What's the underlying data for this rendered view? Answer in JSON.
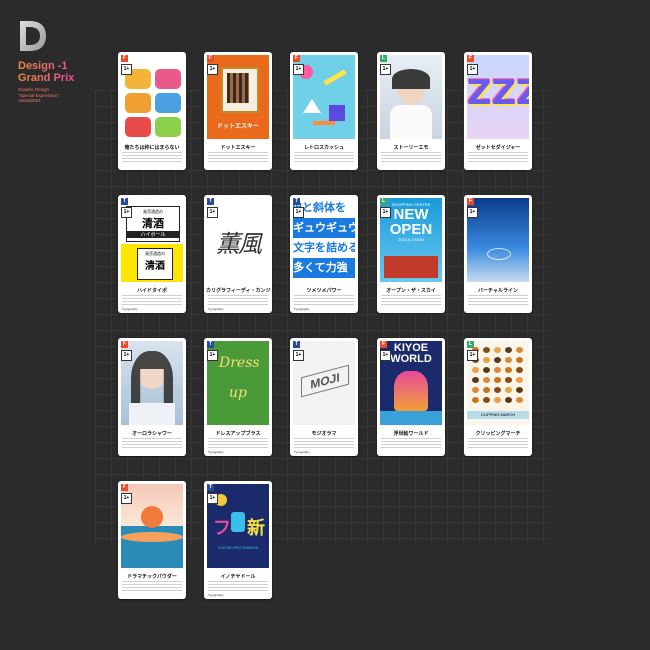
{
  "brand": {
    "logo_letter": "D",
    "title_line1": "Design -1",
    "title_line2": "Grand Prix",
    "sub_lines": [
      "Graphic Design",
      "\"Special Expression\"",
      "Award2024"
    ]
  },
  "colors": {
    "background": "#2b2b2b",
    "accent_orange": "#f08a3c",
    "accent_pink": "#e84a9a"
  },
  "cards": [
    {
      "name": "俺たちは枠にはまらない",
      "badge": "F",
      "badge_color": "#e84a2a",
      "level": "1+",
      "category": "",
      "art": "photo-grid-pets"
    },
    {
      "name": "ドットエスキー",
      "badge": "F",
      "badge_color": "#e84a2a",
      "level": "1+",
      "category": "",
      "art": "pixel-portrait"
    },
    {
      "name": "レトロスカッシュ",
      "badge": "F",
      "badge_color": "#e84a2a",
      "level": "1+",
      "category": "",
      "art": "memphis-pattern"
    },
    {
      "name": "ストーリーエモ",
      "badge": "L",
      "badge_color": "#3aa86b",
      "level": "1+",
      "category": "",
      "art": "portrait-photo"
    },
    {
      "name": "ゼットセダイジャー",
      "badge": "F",
      "badge_color": "#e84a2a",
      "level": "1+",
      "category": "",
      "art": "zzz-letters"
    },
    {
      "name": "ハイドタイポ",
      "badge": "T",
      "badge_color": "#2a4d9a",
      "level": "1+",
      "category": "Typography",
      "art": "sake-label"
    },
    {
      "name": "カリグラフィーディ・カンジ",
      "badge": "T",
      "badge_color": "#2a4d9a",
      "level": "1+",
      "category": "Typography",
      "art": "calligraphy"
    },
    {
      "name": "ツメツメパワー",
      "badge": "T",
      "badge_color": "#2a4d9a",
      "level": "1+",
      "category": "Typography",
      "art": "blue-kana"
    },
    {
      "name": "オープン・ザ・スカイ",
      "badge": "L",
      "badge_color": "#3aa86b",
      "level": "1+",
      "category": "",
      "art": "new-open"
    },
    {
      "name": "バーチャルライン",
      "badge": "F",
      "badge_color": "#e84a2a",
      "level": "1+",
      "category": "",
      "art": "blue-photo"
    },
    {
      "name": "オーロラシャワー",
      "badge": "F",
      "badge_color": "#e84a2a",
      "level": "1+",
      "category": "",
      "art": "aurora-portrait"
    },
    {
      "name": "ドレスアップブラス",
      "badge": "T",
      "badge_color": "#2a4d9a",
      "level": "1+",
      "category": "Typography",
      "art": "dress-up"
    },
    {
      "name": "モジオラマ",
      "badge": "T",
      "badge_color": "#2a4d9a",
      "level": "1+",
      "category": "Typography",
      "art": "moji-3d"
    },
    {
      "name": "浮世絵ワールド",
      "badge": "F",
      "badge_color": "#e84a2a",
      "level": "1+",
      "category": "",
      "art": "kiyoe-world"
    },
    {
      "name": "クリッピングマーチ",
      "badge": "L",
      "badge_color": "#3aa86b",
      "level": "1+",
      "category": "",
      "art": "clipping-march"
    },
    {
      "name": "ドラマチックパウダー",
      "badge": "F",
      "badge_color": "#e84a2a",
      "level": "1+",
      "category": "",
      "art": "dramatic-sunset"
    },
    {
      "name": "イノチヤドール",
      "badge": "T",
      "badge_color": "#2a4d9a",
      "level": "1+",
      "category": "Typography",
      "art": "space-kanji"
    }
  ],
  "art_text": {
    "dot_title": "ドットエスキー",
    "sake_top": "発売酒造の",
    "sake_mid": "清酒",
    "sake_hb": "ハイボール",
    "calli": "薫風",
    "kana1": "線と斜体を",
    "kana2": "ギュウギュウ",
    "kana3": "文字を詰める",
    "kana4": "多くて力強",
    "open_top": "SHOPPING CENTER",
    "open_new": "NEW",
    "open_open": "OPEN",
    "open_date": "2024.6.3 MON",
    "dress1": "Dress",
    "dress2": "up",
    "moji": "MOJI",
    "kiyoe1": "KIYOE",
    "kiyoe2": "WORLD",
    "clip": "CLIPPING MARCH",
    "space1": "フ",
    "space2": "新",
    "space3": "YOU MEI PRO SHINDUN",
    "zzz": "ZZZ"
  }
}
